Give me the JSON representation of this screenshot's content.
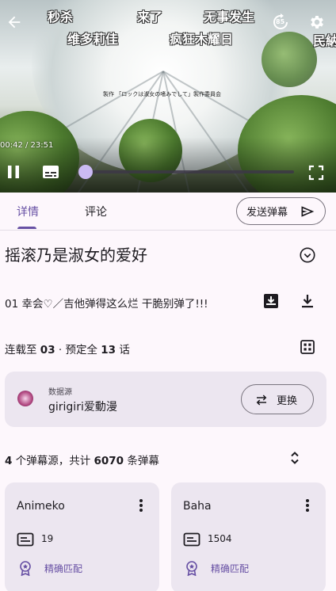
{
  "player": {
    "danmaku": [
      {
        "text": "秒杀"
      },
      {
        "text": "来了"
      },
      {
        "text": "无事发生"
      },
      {
        "text": "维多莉佳"
      },
      {
        "text": "疯狂木耀日"
      },
      {
        "text": "民納"
      }
    ],
    "credit_text": "製作 「ロックは淑女の嗜みでして」製作委員会",
    "timecode": "00:42 / 23:51",
    "skip_badge": "85",
    "progress": 0.02,
    "icons": {
      "back": "arrow-back-icon",
      "skip": "skip-forward-icon",
      "settings": "gear-icon",
      "pause": "pause-icon",
      "subtitle": "subtitles-icon",
      "fullscreen": "fullscreen-icon"
    }
  },
  "tabs": [
    {
      "label": "详情",
      "active": true
    },
    {
      "label": "评论",
      "active": false
    }
  ],
  "send_danmaku_label": "发送弹幕",
  "anime": {
    "title": "摇滚乃是淑女的爱好",
    "episode_line": "01  幸会♡／吉他弹得这么烂 干脆别弹了!!!",
    "status_prefix": "连载至 ",
    "status_current": "03",
    "status_middle": " · 预定全 ",
    "status_total": "13",
    "status_suffix": " 话"
  },
  "source": {
    "caption": "数据源",
    "name": "girigiri爱動漫",
    "swap_label": "更换"
  },
  "danmaku_summary": {
    "count_sources": "4",
    "middle": " 个弹幕源，共计 ",
    "total": "6070",
    "suffix": " 条弹幕"
  },
  "danmaku_sources": [
    {
      "name": "Animeko",
      "count": "19",
      "match": "精确匹配"
    },
    {
      "name": "Baha",
      "count": "1504",
      "match": "精确匹配"
    }
  ],
  "colors": {
    "accent": "#6750a4",
    "surface": "#fdf7fc",
    "card": "#ece6f0",
    "slider_thumb": "#cbbaf3"
  }
}
